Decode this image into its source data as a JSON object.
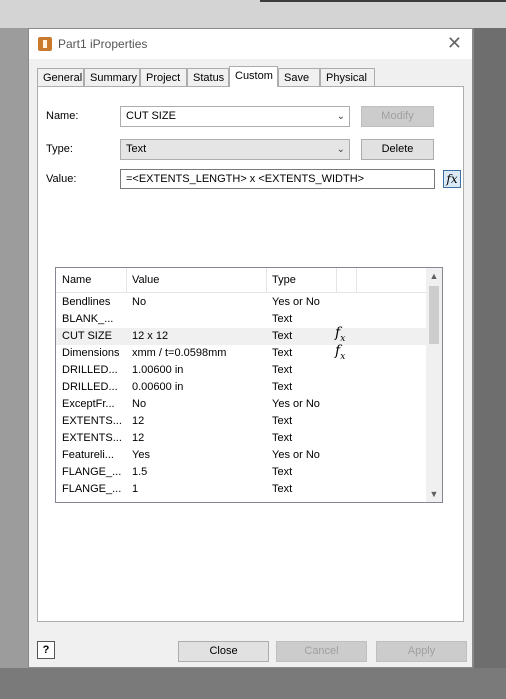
{
  "window": {
    "title": "Part1 iProperties"
  },
  "tabs": [
    {
      "label": "General"
    },
    {
      "label": "Summary"
    },
    {
      "label": "Project"
    },
    {
      "label": "Status"
    },
    {
      "label": "Custom"
    },
    {
      "label": "Save"
    },
    {
      "label": "Physical"
    }
  ],
  "active_tab": "Custom",
  "form": {
    "name_label": "Name:",
    "name_value": "CUT SIZE",
    "type_label": "Type:",
    "type_value": "Text",
    "value_label": "Value:",
    "value_value": "=<EXTENTS_LENGTH> x <EXTENTS_WIDTH>",
    "modify_label": "Modify",
    "delete_label": "Delete",
    "fx_symbol": "fx"
  },
  "table": {
    "columns": [
      "Name",
      "Value",
      "Type"
    ],
    "rows": [
      {
        "name": "Bendlines",
        "value": "No",
        "type": "Yes or No"
      },
      {
        "name": "BLANK_...",
        "value": "",
        "type": "Text"
      },
      {
        "name": "CUT SIZE",
        "value": "12 x 12",
        "type": "Text",
        "fx": true,
        "selected": true
      },
      {
        "name": "Dimensions",
        "value": "xmm / t=0.0598mm",
        "type": "Text",
        "fx": true
      },
      {
        "name": "DRILLED...",
        "value": "1.00600 in",
        "type": "Text"
      },
      {
        "name": "DRILLED...",
        "value": "0.00600 in",
        "type": "Text"
      },
      {
        "name": "ExceptFr...",
        "value": "No",
        "type": "Yes or No"
      },
      {
        "name": "EXTENTS...",
        "value": "12",
        "type": "Text"
      },
      {
        "name": "EXTENTS...",
        "value": "12",
        "type": "Text"
      },
      {
        "name": "Featureli...",
        "value": "Yes",
        "type": "Yes or No"
      },
      {
        "name": "FLANGE_...",
        "value": "1.5",
        "type": "Text"
      },
      {
        "name": "FLANGE_...",
        "value": "1",
        "type": "Text"
      }
    ]
  },
  "buttons": {
    "close": "Close",
    "cancel": "Cancel",
    "apply": "Apply",
    "help": "?"
  }
}
